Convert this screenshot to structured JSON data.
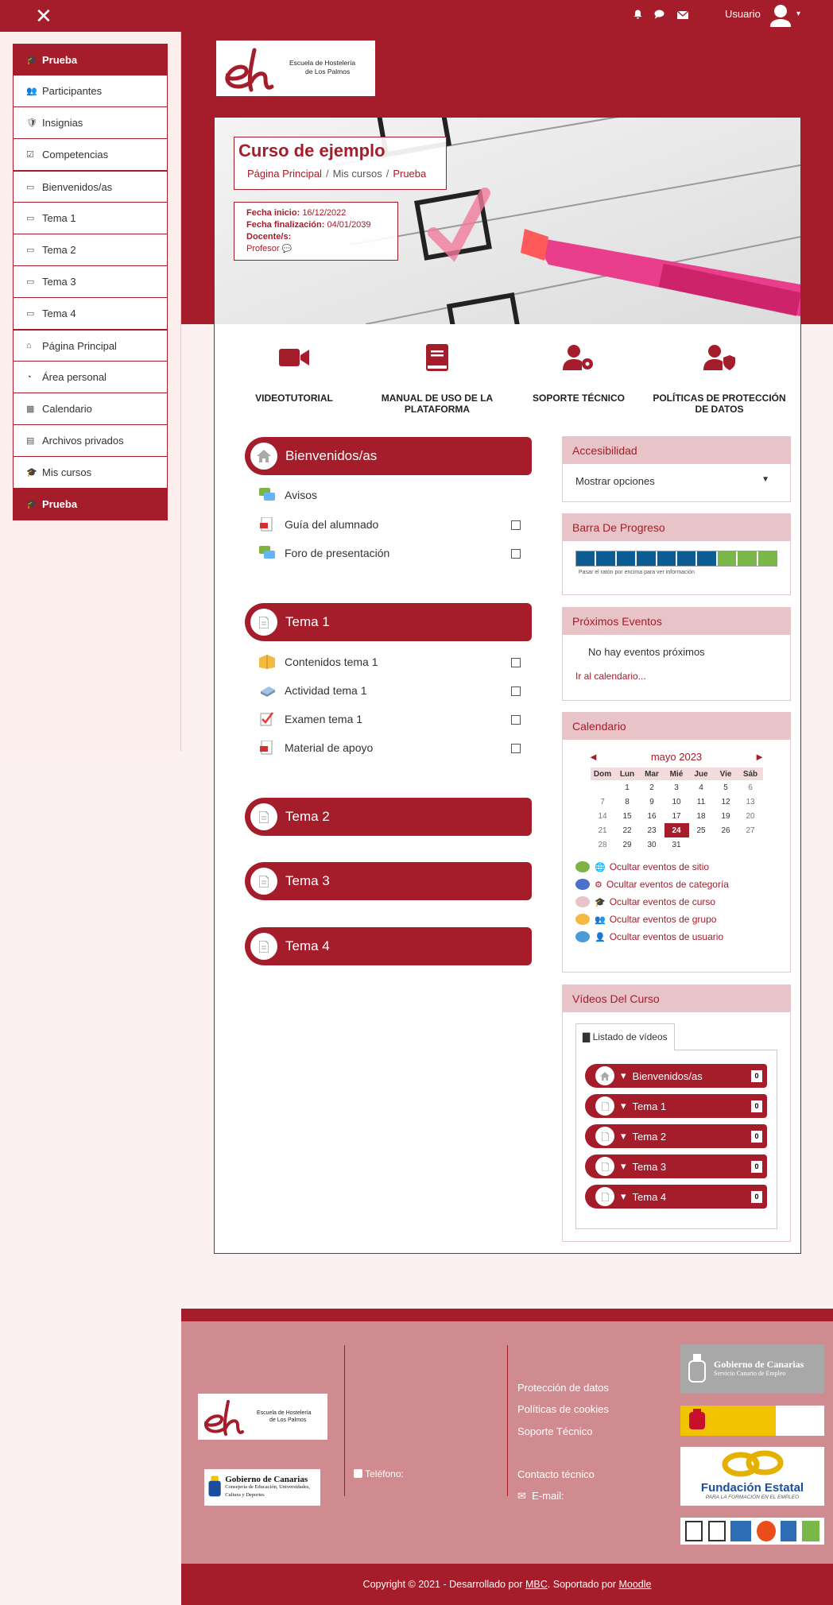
{
  "topbar": {
    "close": "✕",
    "user_label": "Usuario"
  },
  "nav": {
    "group1": [
      {
        "label": "Prueba",
        "active": true
      },
      {
        "label": "Participantes"
      },
      {
        "label": "Insignias"
      },
      {
        "label": "Competencias"
      }
    ],
    "group2": [
      {
        "label": "Bienvenidos/as"
      },
      {
        "label": "Tema 1"
      },
      {
        "label": "Tema 2"
      },
      {
        "label": "Tema 3"
      },
      {
        "label": "Tema 4"
      }
    ],
    "group3": [
      {
        "label": "Página Principal"
      },
      {
        "label": "Área personal"
      },
      {
        "label": "Calendario"
      },
      {
        "label": "Archivos privados"
      },
      {
        "label": "Mis cursos"
      },
      {
        "label": "Prueba",
        "active": true
      }
    ]
  },
  "logo": {
    "line1": "Escuela de Hostelería",
    "line2": "de Los Palmos"
  },
  "course": {
    "title": "Curso de ejemplo",
    "breadcrumb": [
      "Página Principal",
      "Mis cursos",
      "Prueba"
    ],
    "start_label": "Fecha inicio:",
    "start_value": "16/12/2022",
    "end_label": "Fecha finalización:",
    "end_value": "04/01/2039",
    "teacher_label": "Docente/s:",
    "teacher_value": "Profesor"
  },
  "quick_links": [
    "VIDEOTUTORIAL",
    "MANUAL DE USO DE LA PLATAFORMA",
    "SOPORTE TÉCNICO",
    "POLÍTICAS DE PROTECCIÓN DE DATOS"
  ],
  "sections": [
    {
      "title": "Bienvenidos/as",
      "activities": [
        {
          "label": "Avisos",
          "check": false
        },
        {
          "label": "Guía del alumnado",
          "check": true
        },
        {
          "label": "Foro de presentación",
          "check": true
        }
      ]
    },
    {
      "title": "Tema 1",
      "activities": [
        {
          "label": "Contenidos tema 1",
          "check": true
        },
        {
          "label": "Actividad tema 1",
          "check": true
        },
        {
          "label": "Examen tema 1",
          "check": true
        },
        {
          "label": "Material de apoyo",
          "check": true
        }
      ]
    },
    {
      "title": "Tema 2"
    },
    {
      "title": "Tema 3"
    },
    {
      "title": "Tema 4"
    }
  ],
  "blocks": {
    "accessibility": {
      "title": "Accesibilidad",
      "select_value": "Mostrar opciones"
    },
    "progress": {
      "title": "Barra De Progreso",
      "hint": "Pasar el ratón por encima para ver información",
      "completed": 7,
      "total": 10,
      "colors": {
        "done": "#0b5d94",
        "todo": "#7ab648"
      }
    },
    "events": {
      "title": "Próximos Eventos",
      "none": "No hay eventos próximos",
      "link": "Ir al calendario..."
    },
    "calendar": {
      "title": "Calendario",
      "month": "mayo 2023",
      "prev": "◄",
      "next": "►",
      "days": [
        "Dom",
        "Lun",
        "Mar",
        "Mié",
        "Jue",
        "Vie",
        "Sáb"
      ],
      "weeks": [
        [
          "",
          "1",
          "2",
          "3",
          "4",
          "5",
          "6"
        ],
        [
          "7",
          "8",
          "9",
          "10",
          "11",
          "12",
          "13"
        ],
        [
          "14",
          "15",
          "16",
          "17",
          "18",
          "19",
          "20"
        ],
        [
          "21",
          "22",
          "23",
          "24",
          "25",
          "26",
          "27"
        ],
        [
          "28",
          "29",
          "30",
          "31",
          "",
          "",
          ""
        ]
      ],
      "today": "24",
      "filters": [
        "Ocultar eventos de sitio",
        "Ocultar eventos de categoría",
        "Ocultar eventos de curso",
        "Ocultar eventos de grupo",
        "Ocultar eventos de usuario"
      ]
    },
    "videos": {
      "title": "Vídeos Del Curso",
      "tab": "Listado de vídeos",
      "items": [
        {
          "label": "Bienvenidos/as",
          "count": "0"
        },
        {
          "label": "Tema 1",
          "count": "0"
        },
        {
          "label": "Tema 2",
          "count": "0"
        },
        {
          "label": "Tema 3",
          "count": "0"
        },
        {
          "label": "Tema 4",
          "count": "0"
        }
      ]
    }
  },
  "footer": {
    "gov_canarias": "Gobierno de Canarias",
    "gov_canarias_sub": "Consejería de Educación, Universidades, Cultura y Deportes",
    "phone_label": "Teléfono:",
    "links": [
      "Protección de datos",
      "Políticas de cookies",
      "Soporte Técnico"
    ],
    "contact": "Contacto técnico",
    "email_label": "E-mail:",
    "sce": "Gobierno de Canarias",
    "sce_sub": "Servicio Canario de Empleo",
    "fundacion": "Fundación Estatal",
    "fundacion_sub": "PARA LA FORMACIÓN EN EL EMPLEO",
    "copy_prefix": "Copyright © 2021 - Desarrollado por",
    "copy_mbc": "MBC",
    "copy_mid": ". Soportado por",
    "copy_moodle": "Moodle"
  }
}
